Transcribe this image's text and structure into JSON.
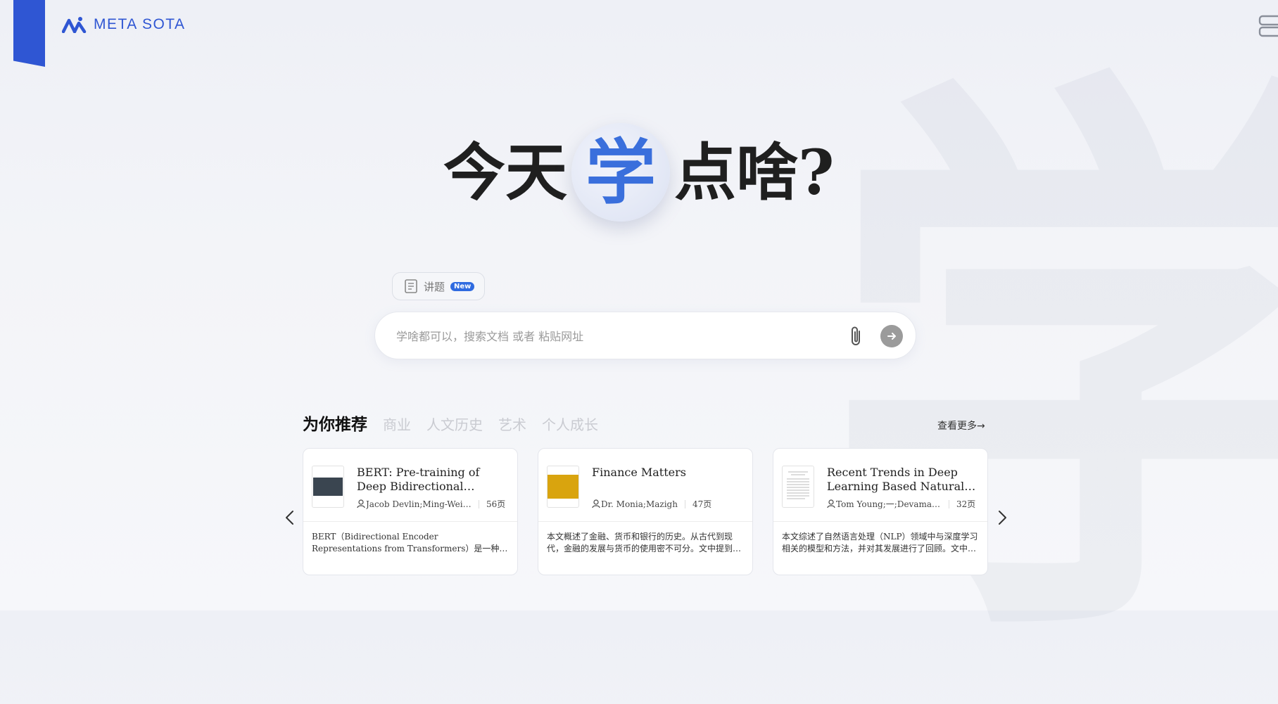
{
  "brand": {
    "name": "META SOTA",
    "accent": "#2f56d3"
  },
  "hero": {
    "before": "今天",
    "highlight": "学",
    "after": "点啥?"
  },
  "background_glyph": "学",
  "mode_chip": {
    "icon": "lecture-icon",
    "label": "讲题",
    "badge": "New"
  },
  "search": {
    "placeholder": "学啥都可以，搜索文档 或者 粘贴网址",
    "value": ""
  },
  "tabs": [
    {
      "label": "为你推荐",
      "active": true
    },
    {
      "label": "商业",
      "active": false
    },
    {
      "label": "人文历史",
      "active": false
    },
    {
      "label": "艺术",
      "active": false
    },
    {
      "label": "个人成长",
      "active": false
    }
  ],
  "more_label": "查看更多→",
  "cards": [
    {
      "title": "BERT: Pre-training of Deep Bidirectional Transformers for Language Understanding",
      "author": "Jacob Devlin;Ming-Wei Chang;Kenton Lee;Kristina Toutanova",
      "pages": "56页",
      "description": "BERT（Bidirectional Encoder Representations from Transformers）是一种用于语言理解的深度双向预训练模型。",
      "thumb_color": "#3a4550"
    },
    {
      "title": "Finance Matters",
      "author": "Dr. Monia;Mazigh",
      "pages": "47页",
      "description": "本文概述了金融、货币和银行的历史。从古代到现代，金融的发展与货币的使用密不可分。文中提到的内容。",
      "thumb_color": "#d9a40e"
    },
    {
      "title": "Recent Trends in Deep Learning Based Natural Language Processing",
      "author": "Tom Young;一;Devamanyu Hazarika;Soujanya Poria;Erik Cambria",
      "pages": "32页",
      "description": "本文综述了自然语言处理（NLP）领域中与深度学习相关的模型和方法，并对其发展进行了回顾。文中提到的内容。",
      "thumb_color": "#ffffff"
    }
  ]
}
